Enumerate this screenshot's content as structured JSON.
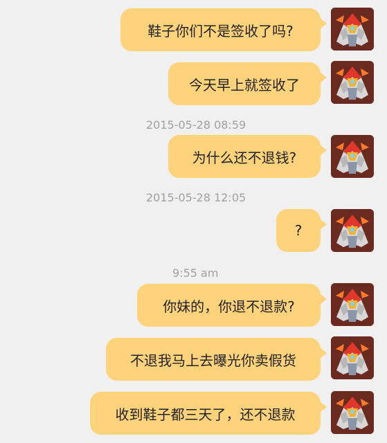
{
  "chat": {
    "timestamps": [
      "2015-05-28 08:59",
      "2015-05-28 12:05",
      "9:55 am"
    ],
    "messages": [
      "鞋子你们不是签收了吗?",
      "今天早上就签收了",
      "为什么还不退钱?",
      "?",
      "你妹的，你退不退款?",
      "不退我马上去曝光你卖假货",
      "收到鞋子都三天了，还不退款"
    ],
    "colors": {
      "background": "#f0f0f0",
      "bubble": "#ffd27c",
      "timestamp": "#a0a0a0"
    },
    "avatar_icon": "robot-avatar-icon"
  }
}
